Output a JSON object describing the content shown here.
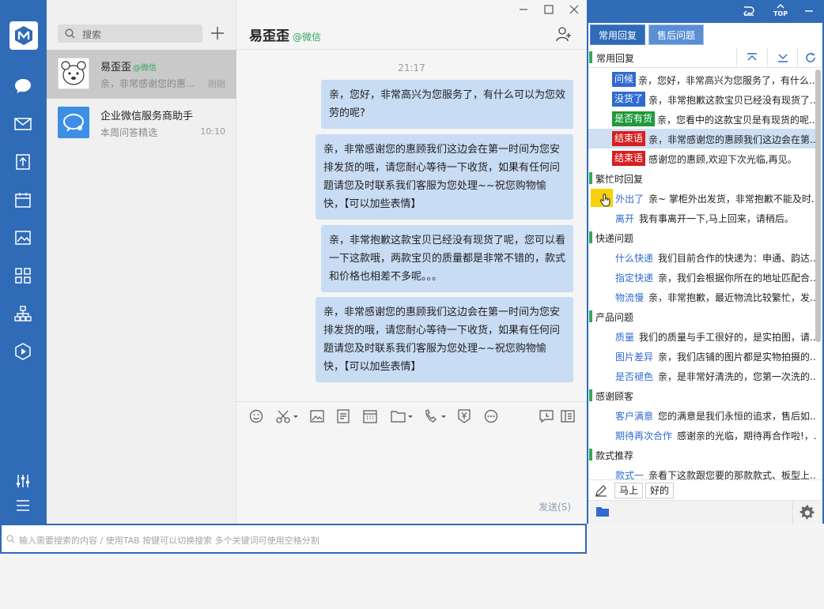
{
  "colors": {
    "brand": "#2f6bb7",
    "bubble": "#c8dcf4",
    "green": "#33a75c"
  },
  "sidebar": {
    "icons": [
      "logo-icon",
      "chat-icon",
      "mail-icon",
      "document-icon",
      "calendar-icon",
      "image-icon",
      "apps-icon",
      "org-chart-icon",
      "play-icon",
      "settings-sliders-icon",
      "menu-icon"
    ]
  },
  "search": {
    "placeholder": "搜索"
  },
  "conversations": [
    {
      "name": "易歪歪",
      "source": "@微信",
      "preview": "亲，非常感谢您的惠...",
      "time": "刚刚"
    },
    {
      "name": "企业微信服务商助手",
      "preview": "本周问答精选",
      "time": "10:10"
    }
  ],
  "chat": {
    "title": "易歪歪",
    "source": "@微信",
    "time": "21:17",
    "messages": [
      "亲，您好，非常高兴为您服务了，有什么可以为您效劳的呢?",
      "亲，非常感谢您的惠顾我们这边会在第一时间为您安排发货的哦，请您耐心等待一下收货，如果有任何问题请您及时联系我们客服为您处理~~祝您购物愉快，【可以加些表情】",
      "亲，非常抱歉这款宝贝已经没有现货了呢，您可以看一下这款哦，两款宝贝的质量都是非常不错的，款式和价格也相差不多呢。。。",
      "亲，非常感谢您的惠顾我们这边会在第一时间为您安排发货的哦，请您耐心等待一下收货，如果有任何问题请您及时联系我们客服为您处理~~祝您购物愉快，【可以加些表情】"
    ],
    "send_label": "发送(S)"
  },
  "bottom_search": {
    "placeholder": "输入需要搜索的内容 / 使用TAB 按键可以切换搜索 多个关键词可使用空格分割"
  },
  "panel": {
    "top_label": "TOP",
    "tabs": [
      "常用回复",
      "售后问题"
    ],
    "section_title": "常用回复",
    "rows": [
      {
        "tag": "问候",
        "color": "#2f6bd0",
        "text": "亲，您好，非常高兴为您服务了，有什么..."
      },
      {
        "tag": "没货了",
        "color": "#2f6bd0",
        "text": "亲，非常抱歉这款宝贝已经没有现货了..."
      },
      {
        "tag": "是否有货",
        "color": "#1f9a3a",
        "text": "亲，您看中的这款宝贝是有现货的呢..."
      },
      {
        "tag": "结束语",
        "color": "#d81e1e",
        "text": "亲，非常感谢您的惠顾我们这边会在第..."
      },
      {
        "tag": "结束语",
        "color": "#d81e1e",
        "text": "感谢您的惠顾,欢迎下次光临,再见。"
      }
    ],
    "categories": [
      {
        "name": "繁忙时回复",
        "items": [
          {
            "label": "外出了",
            "text": "亲~ 掌柜外出发货，非常抱歉不能及时..."
          },
          {
            "label": "离开",
            "text": "我有事离开一下,马上回来，请稍后。"
          }
        ]
      },
      {
        "name": "快递问题",
        "items": [
          {
            "label": "什么快递",
            "text": "我们目前合作的快递为：申通、韵达..."
          },
          {
            "label": "指定快递",
            "text": "亲，我们会根据你所在的地址匹配合..."
          },
          {
            "label": "物流慢",
            "text": "亲，非常抱歉，最近物流比较繁忙，发..."
          }
        ]
      },
      {
        "name": "产品问题",
        "items": [
          {
            "label": "质量",
            "text": "我们的质量与手工很好的，是实拍图，请..."
          },
          {
            "label": "图片差异",
            "text": "亲，我们店铺的图片都是实物拍摄的..."
          },
          {
            "label": "是否褪色",
            "text": "亲，是非常好清洗的，您第一次洗的..."
          }
        ]
      },
      {
        "name": "感谢顾客",
        "items": [
          {
            "label": "客户满意",
            "text": "您的满意是我们永恒的追求，售后如..."
          },
          {
            "label": "期待再次合作",
            "text": "感谢亲的光临，期待再合作啦!，..."
          }
        ]
      },
      {
        "name": "款式推荐",
        "items": [
          {
            "label": "款式一",
            "text": "亲看下这款跟您要的那款款式、板型上..."
          }
        ]
      }
    ],
    "chips": [
      "马上",
      "好的"
    ]
  }
}
